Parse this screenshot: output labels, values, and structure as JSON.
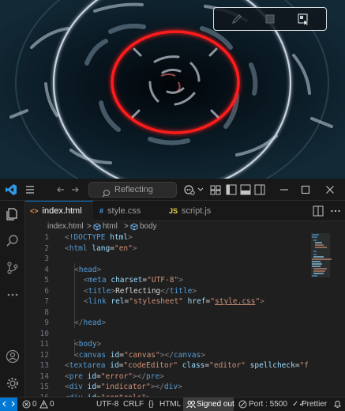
{
  "preview": {
    "colors": {
      "background": "#06121a",
      "ring_outer": "#d7e1f0",
      "ring_inner": "#ff1a1a"
    }
  },
  "float_toolbar": {
    "buttons": [
      {
        "icon": "pencil-icon"
      },
      {
        "icon": "square-icon"
      },
      {
        "icon": "window-icon"
      }
    ]
  },
  "titlebar": {
    "search_text": "Reflecting",
    "icons": [
      "vscode-logo-icon",
      "menu-icon",
      "arrow-left-icon",
      "arrow-right-icon",
      "copilot-icon",
      "chevron-down-icon",
      "layout-icon",
      "sidebar-left-icon",
      "panel-icon",
      "sidebar-right-icon",
      "minimize-icon",
      "maximize-icon",
      "close-icon"
    ]
  },
  "tabs": [
    {
      "icon": "<>",
      "label": "index.html",
      "active": true
    },
    {
      "icon": "#",
      "label": "style.css",
      "active": false
    },
    {
      "icon": "JS",
      "label": "script.js",
      "active": false
    }
  ],
  "breadcrumb": {
    "file": "index.html",
    "sep": ">",
    "item1": "html",
    "item2": "body"
  },
  "code": {
    "line_numbers": [
      "1",
      "2",
      "3",
      "4",
      "5",
      "6",
      "7",
      "8",
      "9",
      "10",
      "11",
      "12",
      "13",
      "14",
      "15",
      "16"
    ]
  },
  "statusbar": {
    "errors": "0",
    "warnings": "0",
    "encoding": "UTF-8",
    "eol": "CRLF",
    "language": "HTML",
    "account": "Signed out",
    "port": "Port : 5500",
    "formatter": "Prettier"
  },
  "colors": {
    "accent": "#0078d4",
    "tag": "#569cd6",
    "attr": "#9cdcfe",
    "string": "#ce9178"
  }
}
